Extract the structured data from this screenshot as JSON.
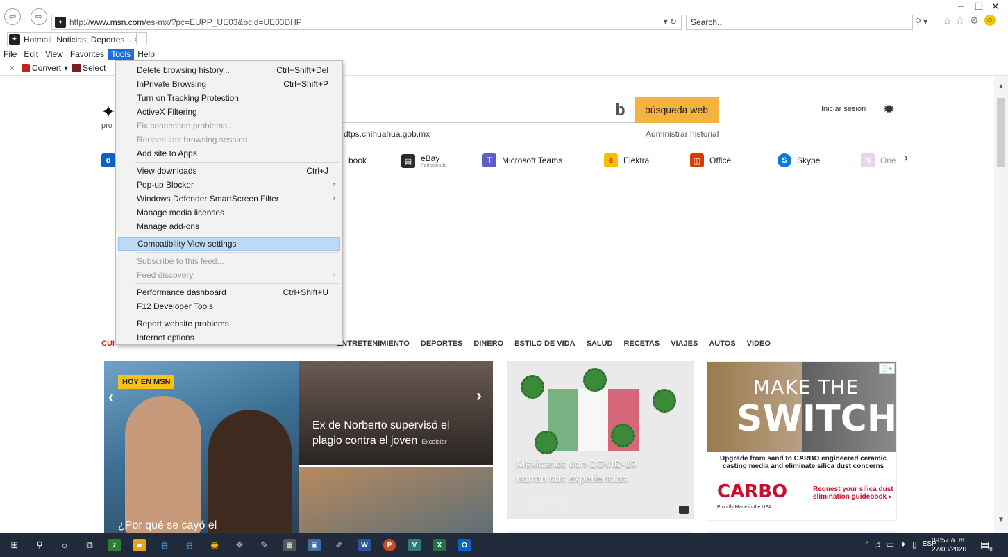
{
  "browser": {
    "url_host": "www.msn.com",
    "url_prefix": "http://",
    "url_path": "/es-mx/?pc=EUPP_UE03&ocid=UE03DHP",
    "search_placeholder": "Search...",
    "tab_title": "Hotmail, Noticias, Deportes...",
    "menubar": [
      "File",
      "Edit",
      "View",
      "Favorites",
      "Tools",
      "Help"
    ],
    "active_menu": "Tools",
    "cmd_convert": "Convert",
    "cmd_select": "Select"
  },
  "tools_menu": {
    "items": [
      {
        "label": "Delete browsing history...",
        "shortcut": "Ctrl+Shift+Del"
      },
      {
        "label": "InPrivate Browsing",
        "shortcut": "Ctrl+Shift+P"
      },
      {
        "label": "Turn on Tracking Protection"
      },
      {
        "label": "ActiveX Filtering"
      },
      {
        "label": "Fix connection problems...",
        "disabled": true
      },
      {
        "label": "Reopen last browsing session",
        "disabled": true
      },
      {
        "label": "Add site to Apps"
      },
      {
        "label": "View downloads",
        "shortcut": "Ctrl+J"
      },
      {
        "label": "Pop-up Blocker",
        "submenu": true
      },
      {
        "label": "Windows Defender SmartScreen Filter",
        "submenu": true
      },
      {
        "label": "Manage media licenses"
      },
      {
        "label": "Manage add-ons"
      },
      {
        "label": "Compatibility View settings",
        "highlight": true
      },
      {
        "label": "Subscribe to this feed...",
        "disabled": true
      },
      {
        "label": "Feed discovery",
        "disabled": true,
        "submenu": true
      },
      {
        "label": "Performance dashboard",
        "shortcut": "Ctrl+Shift+U"
      },
      {
        "label": "F12 Developer Tools"
      },
      {
        "label": "Report website problems"
      },
      {
        "label": "Internet options"
      }
    ]
  },
  "msn": {
    "logo_sub": "pro",
    "bing_button": "búsqueda web",
    "history_query": "dtps.chihuahua.gob.mx",
    "history_link": "Administrar historial",
    "login": "Iniciar sesión",
    "quicklinks": [
      {
        "label": "book",
        "icon": "outlook-icon",
        "color": "#0a64c8"
      },
      {
        "label": "eBay",
        "sub": "Patrocinado",
        "icon": "shopping-bag-icon",
        "color": "#2b2b2b"
      },
      {
        "label": "Microsoft Teams",
        "icon": "teams-icon",
        "color": "#5b5fc7"
      },
      {
        "label": "Elektra",
        "icon": "elektra-icon",
        "color": "#f2c200"
      },
      {
        "label": "Office",
        "icon": "office-icon",
        "color": "#d83b01"
      },
      {
        "label": "Skype",
        "icon": "skype-icon",
        "color": "#0a7cd8"
      },
      {
        "label": "One",
        "icon": "onenote-icon",
        "color": "#c8a4d8"
      }
    ],
    "categories_first": "CUI",
    "categories": [
      "ENTRETENIMIENTO",
      "DEPORTES",
      "DINERO",
      "ESTILO DE VIDA",
      "SALUD",
      "RECETAS",
      "VIAJES",
      "AUTOS",
      "VIDEO"
    ],
    "hero_badge": "HOY EN MSN",
    "hero_caption": "¿Por qué se cayó el",
    "mid_caption": "Ex de Norberto supervisó el plagio contra el joven",
    "mid_source": "Excelsior",
    "covid_caption": "Mexicanos con COVID-19 narran sus experiencias",
    "covid_source": "Quinto Poder",
    "ad": {
      "make": "MAKE THE",
      "switch": "SWITCH",
      "text": "Upgrade from sand to CARBO engineered ceramic casting media and eliminate silica dust concerns",
      "brand": "CARBO",
      "made": "Proudly Made in the USA",
      "request": "Request your silica dust elimination guidebook ▸"
    }
  },
  "taskbar": {
    "language": "ESP",
    "time": "09:57 a. m.",
    "date": "27/03/2020",
    "notif_count": "8"
  }
}
